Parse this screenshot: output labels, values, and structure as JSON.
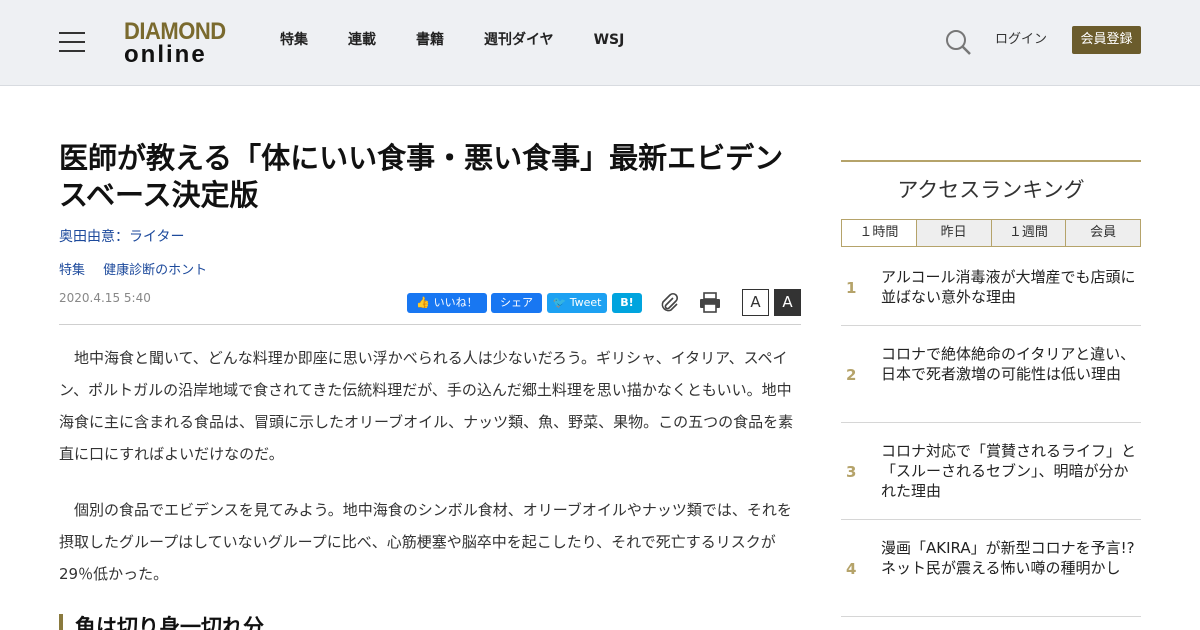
{
  "header": {
    "logo_line1": "DIAMOND",
    "logo_line2": "online",
    "nav": [
      "特集",
      "連載",
      "書籍",
      "週刊ダイヤ",
      "WSJ"
    ],
    "login": "ログイン",
    "register": "会員登録"
  },
  "article": {
    "title": "医師が教える「体にいい食事・悪い食事」最新エビデンスベース決定版",
    "author": "奥田由意：ライター",
    "tags": [
      "特集",
      "健康診断のホント"
    ],
    "date": "2020.4.15 5:40",
    "share": {
      "like": "いいね！",
      "facebook": "シェア",
      "tweet": "Tweet",
      "hatena": "B!"
    },
    "font_small": "A",
    "font_large": "A",
    "paragraphs": [
      "地中海食と聞いて、どんな料理か即座に思い浮かべられる人は少ないだろう。ギリシャ、イタリア、スペイン、ポルトガルの沿岸地域で食されてきた伝統料理だが、手の込んだ郷土料理を思い描かなくともいい。地中海食に主に含まれる食品は、冒頭に示したオリーブオイル、ナッツ類、魚、野菜、果物。この五つの食品を素直に口にすればよいだけなのだ。",
      "個別の食品でエビデンスを見てみよう。地中海食のシンボル食材、オリーブオイルやナッツ類では、それを摂取したグループはしていないグループに比べ、心筋梗塞や脳卒中を起こしたり、それで死亡するリスクが29％低かった。"
    ],
    "subhead": "魚は切り身一切れ分"
  },
  "ranking": {
    "title": "アクセスランキング",
    "tabs": [
      "１時間",
      "昨日",
      "１週間",
      "会員"
    ],
    "items": [
      {
        "rank": "1",
        "text": "アルコール消毒液が大増産でも店頭に並ばない意外な理由"
      },
      {
        "rank": "2",
        "text": "コロナで絶体絶命のイタリアと違い、日本で死者激増の可能性は低い理由"
      },
      {
        "rank": "3",
        "text": "コロナ対応で「賞賛されるライフ」と「スルーされるセブン」、明暗が分かれた理由"
      },
      {
        "rank": "4",
        "text": "漫画「AKIRA」が新型コロナを予言!?ネット民が震える怖い噂の種明かし"
      }
    ]
  },
  "colors": {
    "brand_gold": "#6b5c2c",
    "accent": "#b5a36a",
    "link": "#1d4a9c"
  }
}
